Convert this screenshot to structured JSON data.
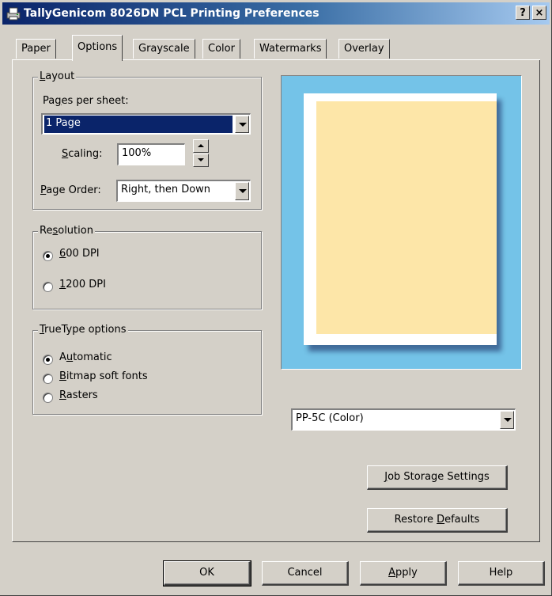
{
  "window": {
    "title": "TallyGenicom 8026DN PCL Printing Preferences",
    "help_btn": "?",
    "close_btn": "×"
  },
  "tabs": [
    {
      "label": "Paper"
    },
    {
      "label": "Options",
      "active": true
    },
    {
      "label": "Grayscale"
    },
    {
      "label": "Color"
    },
    {
      "label": "Watermarks"
    },
    {
      "label": "Overlay"
    }
  ],
  "layout": {
    "legend_u": "L",
    "legend_rest": "ayout",
    "pps_pre": "Pa",
    "pps_u": "g",
    "pps_post": "es per sheet:",
    "pps_value": "1 Page",
    "scaling_u": "S",
    "scaling_rest": "caling:",
    "scaling_value": "100%",
    "page_order_u": "P",
    "page_order_rest": "age Order:",
    "page_order_value": "Right, then Down"
  },
  "resolution": {
    "legend_pre": "Re",
    "legend_u": "s",
    "legend_post": "olution",
    "opt1_u": "6",
    "opt1_rest": "00 DPI",
    "opt2_u": "1",
    "opt2_rest": "200 DPI",
    "selected": "600 DPI"
  },
  "truetype": {
    "legend_u": "T",
    "legend_rest": "rueType options",
    "opt1_pre": "A",
    "opt1_u": "u",
    "opt1_post": "tomatic",
    "opt2_u": "B",
    "opt2_rest": "itmap soft fonts",
    "opt3_u": "R",
    "opt3_rest": "asters",
    "selected": "Automatic"
  },
  "preview": {
    "background_color": "#74c3e8",
    "content_color": "#fde6a8"
  },
  "printer_model": "PP-5C (Color)",
  "buttons": {
    "job_storage_u": "J",
    "job_storage_rest": "ob Storage Settings",
    "restore_pre": "Restore ",
    "restore_u": "D",
    "restore_post": "efaults",
    "ok": "OK",
    "cancel": "Cancel",
    "apply_u": "A",
    "apply_rest": "pply",
    "help": "Help"
  }
}
